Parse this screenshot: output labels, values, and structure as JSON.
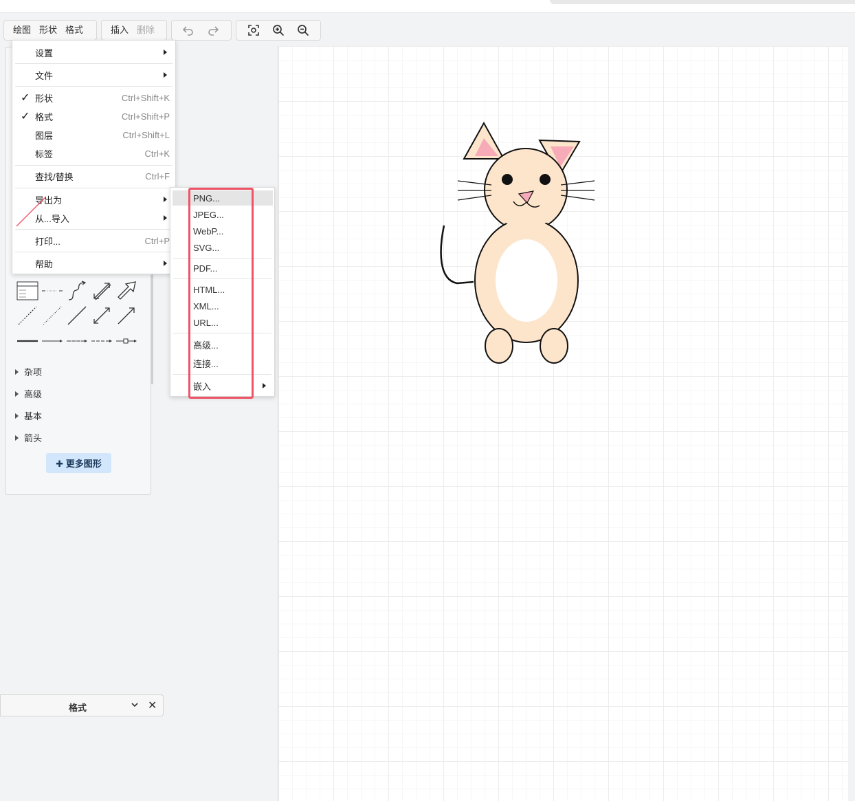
{
  "toolbar": {
    "draw": "绘图",
    "shape": "形状",
    "format": "格式",
    "insert": "插入",
    "delete": "删除"
  },
  "main_menu": {
    "settings": "设置",
    "file": "文件",
    "shape": {
      "label": "形状",
      "shortcut": "Ctrl+Shift+K",
      "checked": true
    },
    "format": {
      "label": "格式",
      "shortcut": "Ctrl+Shift+P",
      "checked": true
    },
    "layers": {
      "label": "图层",
      "shortcut": "Ctrl+Shift+L"
    },
    "tags": {
      "label": "标签",
      "shortcut": "Ctrl+K"
    },
    "find_replace": {
      "label": "查找/替换",
      "shortcut": "Ctrl+F"
    },
    "export_as": "导出为",
    "import_from": "从...导入",
    "print": {
      "label": "打印...",
      "shortcut": "Ctrl+P"
    },
    "help": "帮助",
    "check_glyph": "✓"
  },
  "export_submenu": {
    "png": "PNG...",
    "jpeg": "JPEG...",
    "webp": "WebP...",
    "svg": "SVG...",
    "pdf": "PDF...",
    "html": "HTML...",
    "xml": "XML...",
    "url": "URL...",
    "advanced": "高级...",
    "link": "连接...",
    "embed": "嵌入"
  },
  "sidebar": {
    "categories": [
      "杂项",
      "高级",
      "基本",
      "箭头"
    ],
    "more_shapes": "✚ 更多图形"
  },
  "format_panel": {
    "title": "格式",
    "close": "✕"
  },
  "colors": {
    "accent_red": "#ee5366",
    "more_button_bg": "#d2e7fb",
    "cat_fill": "#fde5cc",
    "ear_pink": "#f7aab8"
  }
}
